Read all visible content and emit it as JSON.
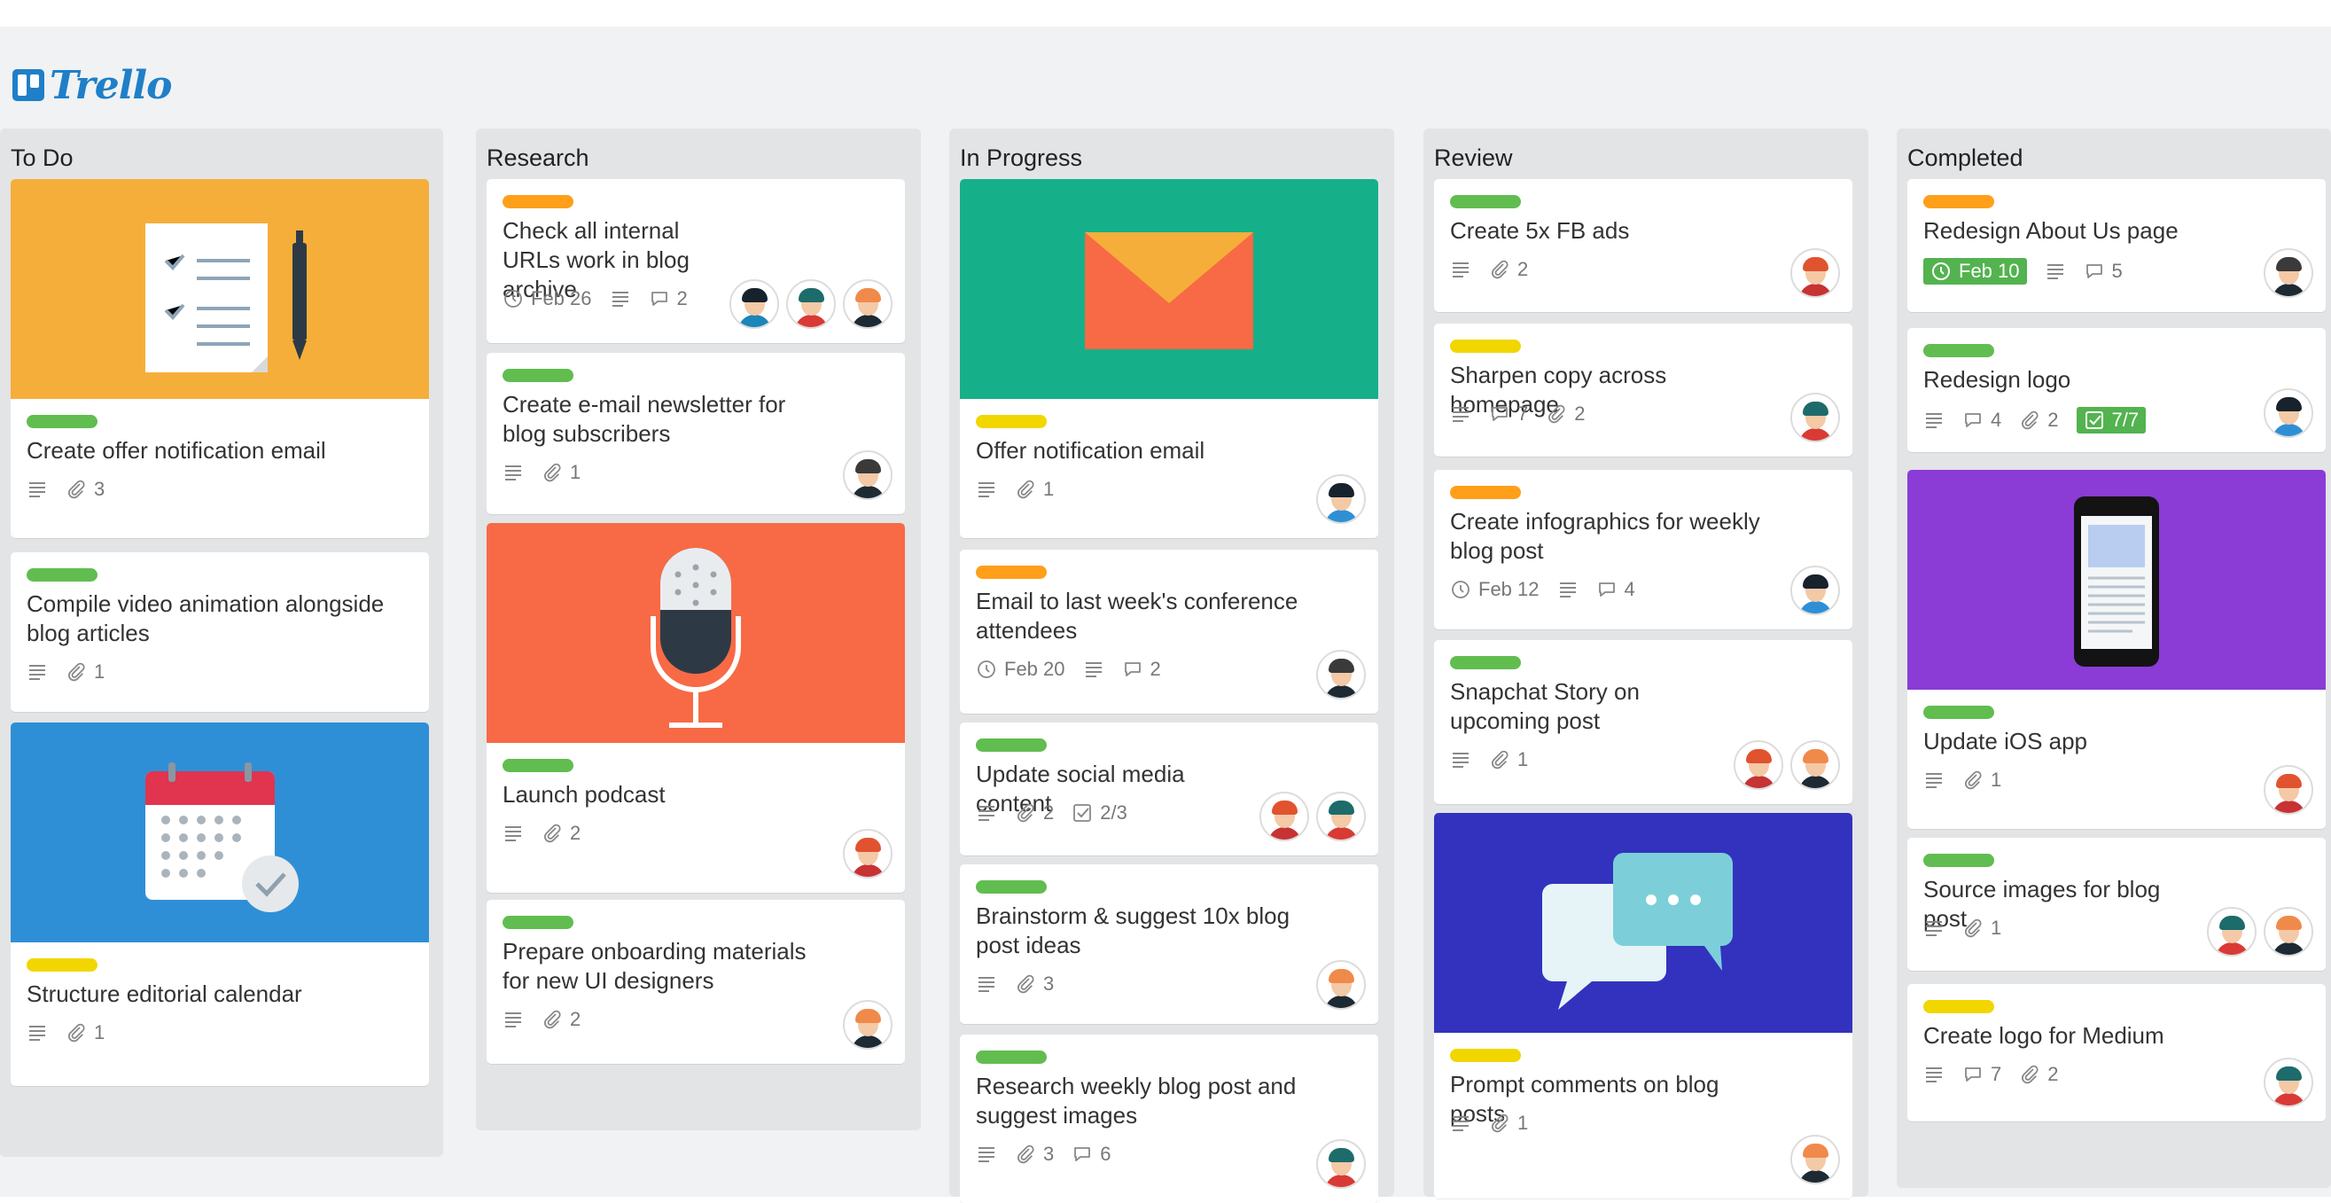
{
  "app": {
    "name": "Trello"
  },
  "colors": {
    "green": "#61bd4f",
    "orange": "#ff9f1a",
    "yellow": "#f2d600"
  },
  "lists": [
    {
      "title": "To Do",
      "cards": [
        {
          "label_color": "#61bd4f",
          "title": "Create offer notification email",
          "badges": {
            "description": true,
            "attachments": "3"
          },
          "cover": "checklist-doc",
          "avatars": []
        },
        {
          "label_color": "#61bd4f",
          "title": "Compile video animation alongside blog articles",
          "badges": {
            "description": true,
            "attachments": "1"
          },
          "avatars": []
        },
        {
          "label_color": "#f2d600",
          "title": "Structure editorial calendar",
          "badges": {
            "description": true,
            "attachments": "1"
          },
          "cover": "calendar",
          "avatars": []
        }
      ]
    },
    {
      "title": "Research",
      "cards": [
        {
          "label_color": "#ff9f1a",
          "title": "Check all internal URLs work in blog archive",
          "badges": {
            "due": "Feb 26",
            "description": true,
            "comments": "2"
          },
          "avatars": [
            "teal-woman",
            "teal-hat",
            "ginger-man"
          ]
        },
        {
          "label_color": "#61bd4f",
          "title": "Create e-mail newsletter for blog subscribers",
          "badges": {
            "description": true,
            "attachments": "1"
          },
          "avatars": [
            "glasses-man"
          ]
        },
        {
          "label_color": "#61bd4f",
          "title": "Launch podcast",
          "badges": {
            "description": true,
            "attachments": "2"
          },
          "cover": "microphone",
          "avatars": [
            "red-woman"
          ]
        },
        {
          "label_color": "#61bd4f",
          "title": "Prepare onboarding materials for new UI designers",
          "badges": {
            "description": true,
            "attachments": "2"
          },
          "avatars": [
            "ginger-man"
          ]
        }
      ]
    },
    {
      "title": "In Progress",
      "cards": [
        {
          "label_color": "#f2d600",
          "title": "Offer notification email",
          "badges": {
            "description": true,
            "attachments": "1"
          },
          "cover": "envelope",
          "avatars": [
            "dark-woman"
          ]
        },
        {
          "label_color": "#ff9f1a",
          "title": "Email to last week's conference attendees",
          "badges": {
            "due": "Feb 20",
            "description": true,
            "comments": "2"
          },
          "avatars": [
            "glasses-man"
          ]
        },
        {
          "label_color": "#61bd4f",
          "title": "Update social media content",
          "badges": {
            "description": true,
            "attachments": "2",
            "checklist": "2/3"
          },
          "avatars": [
            "red-woman",
            "teal-hat"
          ]
        },
        {
          "label_color": "#61bd4f",
          "title": "Brainstorm & suggest 10x blog post ideas",
          "badges": {
            "description": true,
            "attachments": "3"
          },
          "avatars": [
            "ginger-man"
          ]
        },
        {
          "label_color": "#61bd4f",
          "title": "Research weekly blog post and suggest images",
          "badges": {
            "description": true,
            "attachments": "3",
            "comments": "6"
          },
          "avatars": [
            "teal-hat"
          ]
        }
      ]
    },
    {
      "title": "Review",
      "cards": [
        {
          "label_color": "#61bd4f",
          "title": "Create 5x FB ads",
          "badges": {
            "description": true,
            "attachments": "2"
          },
          "avatars": [
            "red-woman"
          ]
        },
        {
          "label_color": "#f2d600",
          "title": "Sharpen copy across homepage",
          "badges": {
            "description": true,
            "comments": "7",
            "attachments": "2"
          },
          "avatars": [
            "teal-hat"
          ]
        },
        {
          "label_color": "#ff9f1a",
          "title": "Create infographics for weekly blog post",
          "badges": {
            "due": "Feb 12",
            "description": true,
            "comments": "4"
          },
          "avatars": [
            "dark-woman"
          ]
        },
        {
          "label_color": "#61bd4f",
          "title": "Snapchat Story on upcoming post",
          "badges": {
            "description": true,
            "attachments": "1"
          },
          "avatars": [
            "red-woman",
            "ginger-man"
          ]
        },
        {
          "label_color": "#f2d600",
          "title": "Prompt comments on blog posts",
          "badges": {
            "description": true,
            "attachments": "1"
          },
          "cover": "chat-bubbles",
          "avatars": [
            "ginger-man"
          ]
        }
      ]
    },
    {
      "title": "Completed",
      "cards": [
        {
          "label_color": "#ff9f1a",
          "title": "Redesign About Us page",
          "badges": {
            "due_done": "Feb 10",
            "description": true,
            "comments": "5"
          },
          "avatars": [
            "glasses-man"
          ]
        },
        {
          "label_color": "#61bd4f",
          "title": "Redesign logo",
          "badges": {
            "description": true,
            "comments": "4",
            "attachments": "2",
            "checklist_done": "7/7"
          },
          "avatars": [
            "dark-woman"
          ]
        },
        {
          "label_color": "#61bd4f",
          "title": "Update iOS app",
          "badges": {
            "description": true,
            "attachments": "1"
          },
          "cover": "phone",
          "avatars": [
            "red-woman"
          ]
        },
        {
          "label_color": "#61bd4f",
          "title": "Source images for blog post",
          "badges": {
            "description": true,
            "attachments": "1"
          },
          "avatars": [
            "teal-hat",
            "ginger-man"
          ]
        },
        {
          "label_color": "#f2d600",
          "title": "Create logo for Medium",
          "badges": {
            "description": true,
            "comments": "7",
            "attachments": "2"
          },
          "avatars": [
            "teal-hat"
          ]
        }
      ]
    }
  ]
}
